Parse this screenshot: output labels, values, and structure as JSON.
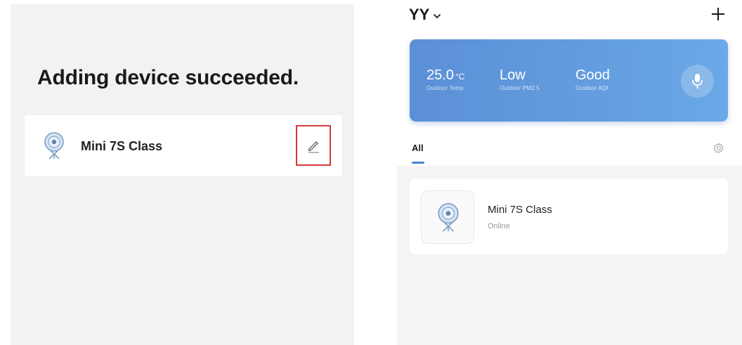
{
  "left": {
    "title": "Adding device succeeded.",
    "device_name": "Mini 7S Class",
    "highlight_color": "#d63a3a"
  },
  "right": {
    "home_name": "YY",
    "weather": {
      "temp_value": "25.0",
      "temp_unit": "°C",
      "temp_label": "Outdoor Temp",
      "pm_value": "Low",
      "pm_label": "Outdoor PM2.5",
      "aqi_value": "Good",
      "aqi_label": "Outdoor AQI"
    },
    "tab_all": "All",
    "device": {
      "name": "Mini 7S Class",
      "status": "Online"
    },
    "accent_color": "#4a82cf"
  },
  "icons": [
    "camera-icon",
    "edit-pencil-icon",
    "chevron-down-icon",
    "plus-icon",
    "microphone-icon",
    "gear-icon"
  ]
}
